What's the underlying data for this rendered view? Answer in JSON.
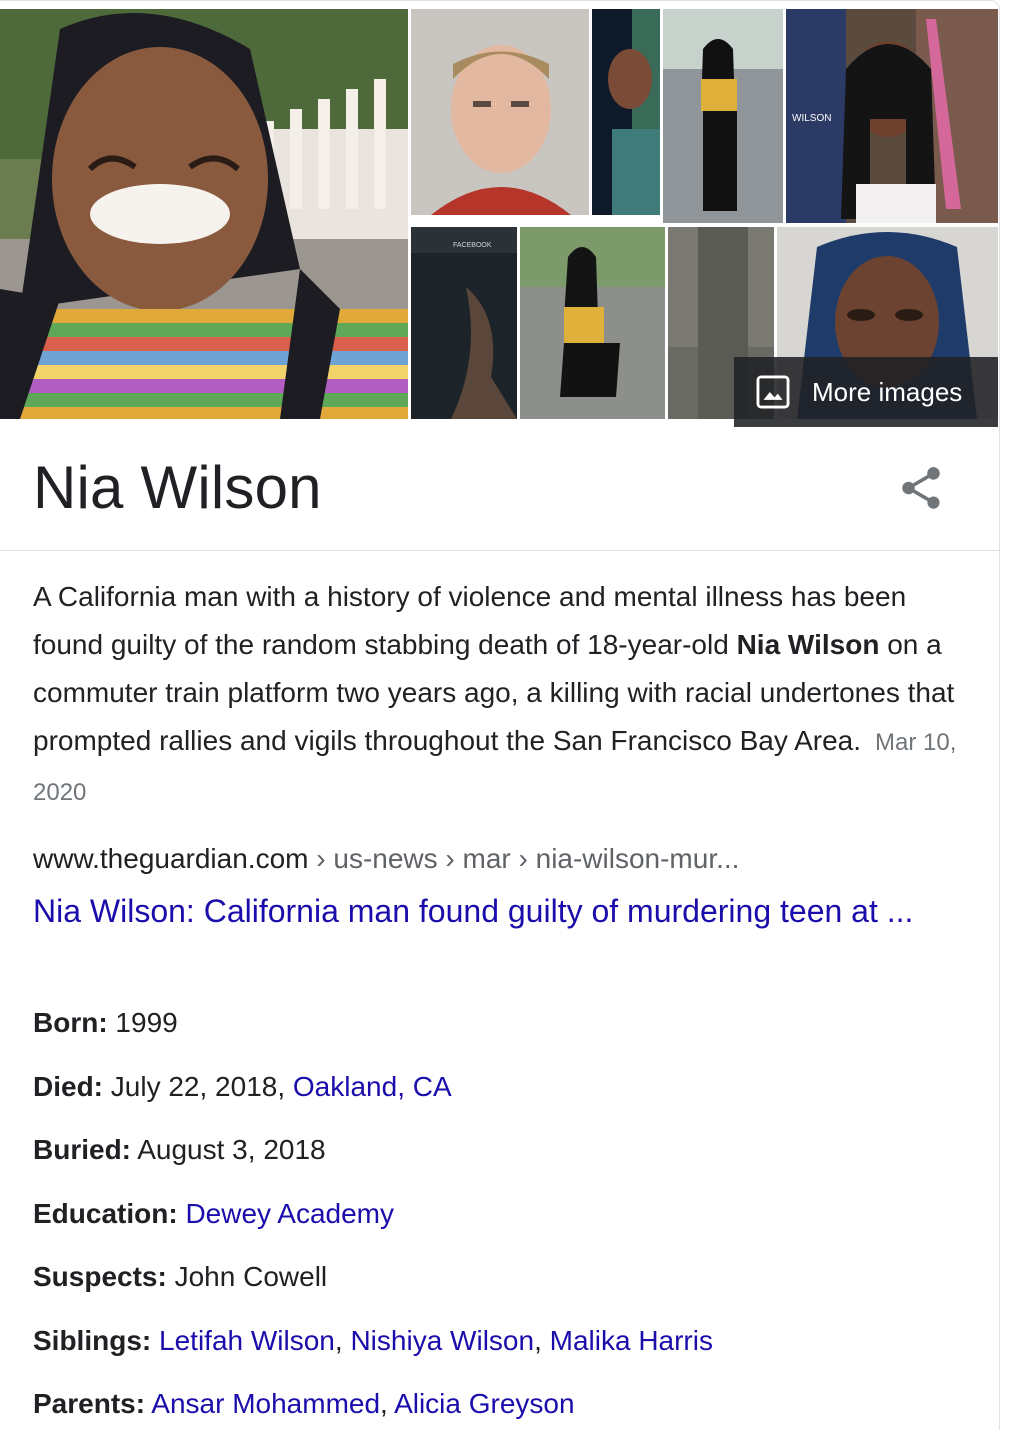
{
  "gallery": {
    "more_images_label": "More images",
    "tile_captions": {
      "wilson": "WILSON",
      "facebook": "FACEBOOK"
    }
  },
  "entity": {
    "title": "Nia Wilson",
    "share_icon": "share-icon"
  },
  "description": {
    "part1": "A California man with a history of violence and mental illness has been found guilty of the random stabbing death of 18-year-old ",
    "bold": "Nia Wilson",
    "part2": " on a commuter train platform two years ago, a killing with racial undertones that prompted rallies and vigils throughout the San Francisco Bay Area.",
    "date": "Mar 10, 2020"
  },
  "source": {
    "domain": "www.theguardian.com",
    "crumbs": " › us-news › mar › nia-wilson-mur...",
    "link_title": "Nia Wilson: California man found guilty of murdering teen at ..."
  },
  "facts": {
    "born": {
      "key": "Born:",
      "value": " 1999"
    },
    "died": {
      "key": "Died:",
      "value": " July 22, 2018, ",
      "link": "Oakland, CA"
    },
    "buried": {
      "key": "Buried:",
      "value": " August 3, 2018"
    },
    "education": {
      "key": "Education:",
      "link": "Dewey Academy"
    },
    "suspects": {
      "key": "Suspects:",
      "value": " John Cowell"
    },
    "siblings": {
      "key": "Siblings:",
      "links": [
        "Letifah Wilson",
        "Nishiya Wilson",
        "Malika Harris"
      ],
      "sep": ", "
    },
    "parents": {
      "key": "Parents:",
      "links": [
        "Ansar Mohammed",
        "Alicia Greyson"
      ],
      "sep": ", "
    }
  },
  "colors": {
    "link": "#1a0dab",
    "text": "#202124",
    "muted": "#70757a",
    "border": "#dfe1e5"
  }
}
